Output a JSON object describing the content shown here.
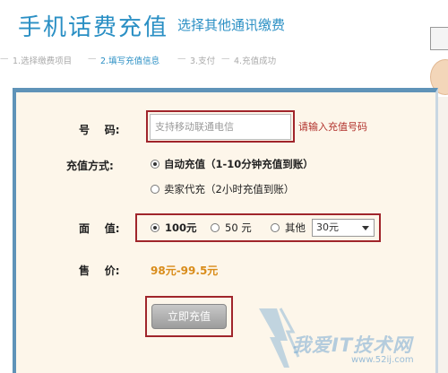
{
  "header": {
    "title": "手机话费充值",
    "subtitle": "选择其他通讯缴费"
  },
  "steps": [
    {
      "label": "1.选择缴费项目",
      "active": false
    },
    {
      "label": "2.填写充值信息",
      "active": true
    },
    {
      "label": "3.支付",
      "active": false
    },
    {
      "label": "4.充值成功",
      "active": false
    }
  ],
  "form": {
    "phone": {
      "label": "号    码:",
      "placeholder": "支持移动联通电信",
      "hint": "请输入充值号码"
    },
    "method": {
      "label": "充值方式:",
      "options": [
        {
          "text": "自动充值（1-10分钟充值到账）",
          "checked": true
        },
        {
          "text": "卖家代充（2小时充值到账）",
          "checked": false
        }
      ]
    },
    "amount": {
      "label": "面    值:",
      "options": [
        {
          "text": "100元",
          "checked": true
        },
        {
          "text": "50 元",
          "checked": false
        },
        {
          "text": "其他",
          "checked": false
        }
      ],
      "select_value": "30元"
    },
    "price": {
      "label": "售    价:",
      "value": "98元-99.5元"
    },
    "submit_label": "立即充值"
  },
  "watermark": {
    "text": "我爱IT技术网",
    "url": "www.52ij.com"
  },
  "colors": {
    "accent": "#2a8fc4",
    "highlight_box": "#a0252b",
    "price": "#d98c1a",
    "panel_bg": "#fdf6ea"
  }
}
